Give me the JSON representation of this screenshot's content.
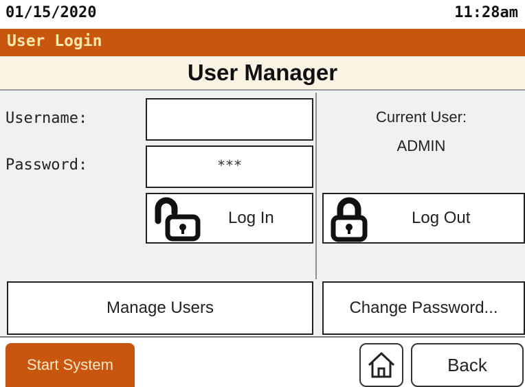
{
  "status": {
    "date": "01/15/2020",
    "time": "11:28am"
  },
  "title_bar": {
    "label": "User Login"
  },
  "header": {
    "title": "User Manager"
  },
  "login_form": {
    "username_label": "Username:",
    "username_value": "",
    "password_label": "Password:",
    "password_value": "***"
  },
  "current_user": {
    "label": "Current User:",
    "name": "ADMIN"
  },
  "buttons": {
    "log_in": "Log In",
    "log_out": "Log Out",
    "manage_users": "Manage Users",
    "change_password": "Change Password...",
    "start_system": "Start System",
    "back": "Back"
  },
  "icons": {
    "log_in": "unlocked-padlock-icon",
    "log_out": "padlock-icon",
    "home": "home-icon"
  },
  "colors": {
    "accent": "#c8560f",
    "accent_text": "#ffe9a8",
    "header_band": "#fbf3e3",
    "panel": "#f1f1f1"
  }
}
